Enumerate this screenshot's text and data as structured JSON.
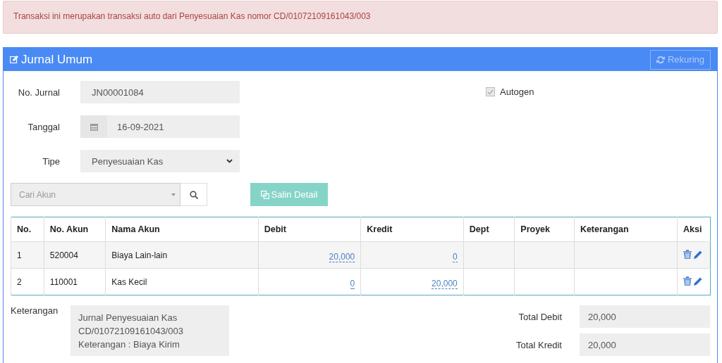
{
  "alert": {
    "message": "Transaksi ini merupakan transaksi auto dari Penyesuaian Kas nomor CD/01072109161043/003"
  },
  "panel": {
    "title": "Jurnal Umum",
    "rekuring_button": {
      "label": "Rekuring",
      "disabled": true
    }
  },
  "form": {
    "no_jurnal": {
      "label": "No. Jurnal",
      "value": "JN00001084"
    },
    "tanggal": {
      "label": "Tanggal",
      "value": "16-09-2021"
    },
    "tipe": {
      "label": "Tipe",
      "value": "Penyesuaian Kas"
    },
    "autogen": {
      "label": "Autogen",
      "checked": true,
      "disabled": true
    }
  },
  "account_search": {
    "placeholder": "Cari Akun"
  },
  "copy_button": {
    "label": "Salin Detail",
    "disabled": true
  },
  "table": {
    "columns": [
      "No.",
      "No. Akun",
      "Nama Akun",
      "Debit",
      "Kredit",
      "Dept",
      "Proyek",
      "Keterangan",
      "Aksi"
    ],
    "rows": [
      {
        "no": "1",
        "account_no": "520004",
        "account_name": "Biaya Lain-lain",
        "debit": "20,000",
        "credit": "0"
      },
      {
        "no": "2",
        "account_no": "110001",
        "account_name": "Kas Kecil",
        "debit": "0",
        "credit": "20,000"
      }
    ]
  },
  "summary": {
    "description": {
      "label": "Keterangan",
      "lines": [
        "Jurnal Penyesuaian Kas",
        "CD/01072109161043/003",
        "Keterangan : Biaya Kirim"
      ]
    },
    "total_debit": {
      "label": "Total Debit",
      "value": "20,000"
    },
    "total_kredit": {
      "label": "Total Kredit",
      "value": "20,000"
    }
  }
}
